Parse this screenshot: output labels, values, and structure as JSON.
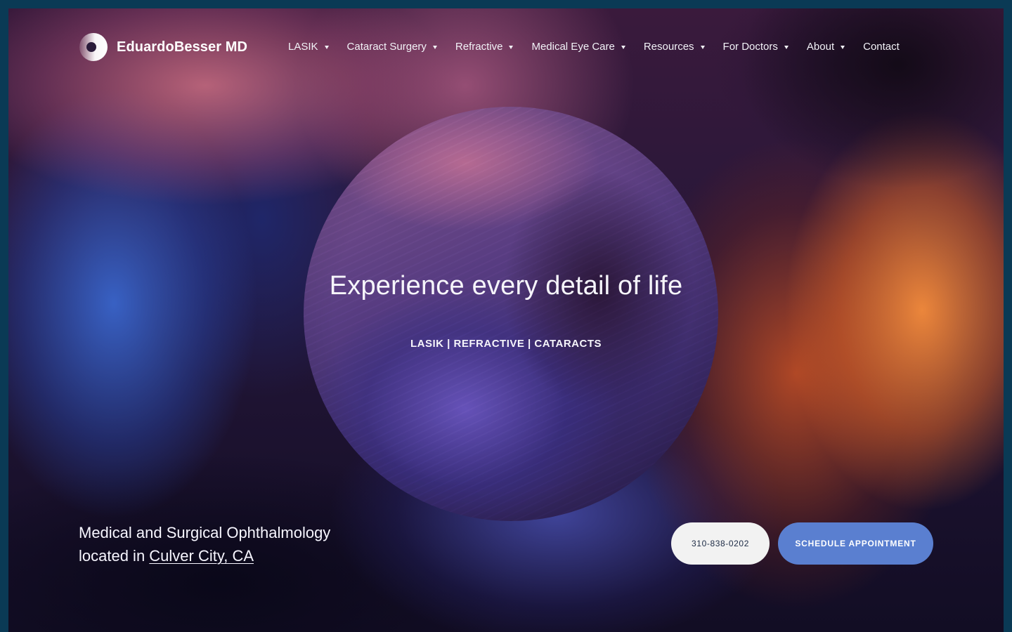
{
  "brand": {
    "name": "EduardoBesser MD"
  },
  "nav": {
    "items": [
      {
        "label": "LASIK",
        "has_dropdown": true
      },
      {
        "label": "Cataract Surgery",
        "has_dropdown": true
      },
      {
        "label": "Refractive",
        "has_dropdown": true
      },
      {
        "label": "Medical Eye Care",
        "has_dropdown": true
      },
      {
        "label": "Resources",
        "has_dropdown": true
      },
      {
        "label": "For Doctors",
        "has_dropdown": true
      },
      {
        "label": "About",
        "has_dropdown": true
      },
      {
        "label": "Contact",
        "has_dropdown": false
      }
    ]
  },
  "hero": {
    "title": "Experience every detail of life",
    "subtitle": "LASIK | REFRACTIVE | CATARACTS"
  },
  "tagline": {
    "line1": "Medical and Surgical Ophthalmology",
    "line2_prefix": "located in ",
    "location": "Culver City, CA"
  },
  "cta": {
    "phone": "310-838-0202",
    "schedule": "SCHEDULE APPOINTMENT"
  },
  "colors": {
    "outer_border": "#0a3a55",
    "appointment_button": "#5a7fd0",
    "phone_button": "#f2f2f2",
    "text": "#f6f5fb"
  },
  "icons": {
    "logo": "eye-logo-icon",
    "dropdown": "caret-down-icon"
  }
}
